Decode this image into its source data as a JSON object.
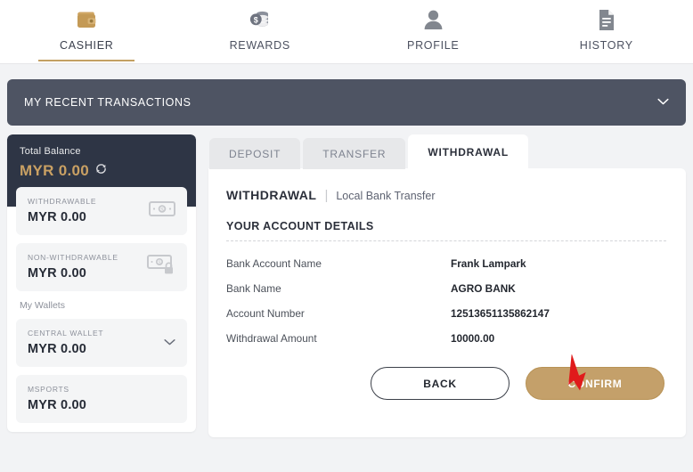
{
  "top_nav": {
    "items": [
      {
        "label": "CASHIER",
        "icon": "wallet-icon",
        "active": true
      },
      {
        "label": "REWARDS",
        "icon": "coins-icon",
        "active": false
      },
      {
        "label": "PROFILE",
        "icon": "person-icon",
        "active": false
      },
      {
        "label": "HISTORY",
        "icon": "document-icon",
        "active": false
      }
    ],
    "active_underline_color": "#c3a062"
  },
  "recent_transactions": {
    "title": "MY RECENT TRANSACTIONS",
    "expand_icon": "chevron-down-icon",
    "background_color": "#4e5463"
  },
  "sidebar": {
    "total_balance_label": "Total Balance",
    "total_balance_value": "MYR 0.00",
    "total_balance_color": "#c9a063",
    "refresh_icon": "refresh-icon",
    "balances": [
      {
        "label": "WITHDRAWABLE",
        "value": "MYR 0.00",
        "icon": "banknote-icon"
      },
      {
        "label": "NON-WITHDRAWABLE",
        "value": "MYR 0.00",
        "icon": "banknote-lock-icon"
      }
    ],
    "wallets_label": "My Wallets",
    "wallets": [
      {
        "label": "CENTRAL WALLET",
        "value": "MYR 0.00",
        "icon": "chevron-down-icon"
      },
      {
        "label": "MSPORTS",
        "value": "MYR 0.00",
        "icon": ""
      }
    ]
  },
  "main": {
    "tabs": [
      {
        "label": "DEPOSIT",
        "active": false
      },
      {
        "label": "TRANSFER",
        "active": false
      },
      {
        "label": "WITHDRAWAL",
        "active": true
      }
    ],
    "heading_main": "WITHDRAWAL",
    "heading_separator": "|",
    "heading_sub": "Local Bank Transfer",
    "section_title": "YOUR ACCOUNT DETAILS",
    "details": [
      {
        "label": "Bank Account Name",
        "value": "Frank Lampark"
      },
      {
        "label": "Bank Name",
        "value": "AGRO BANK"
      },
      {
        "label": "Account Number",
        "value": "12513651135862147"
      },
      {
        "label": "Withdrawal Amount",
        "value": "10000.00"
      }
    ],
    "back_label": "BACK",
    "confirm_label": "CONFIRM",
    "confirm_color": "#c4a06a"
  },
  "annotation": {
    "arrow_icon": "red-arrow-icon",
    "arrow_color": "#e01b1b",
    "points_to": "CONFIRM"
  }
}
